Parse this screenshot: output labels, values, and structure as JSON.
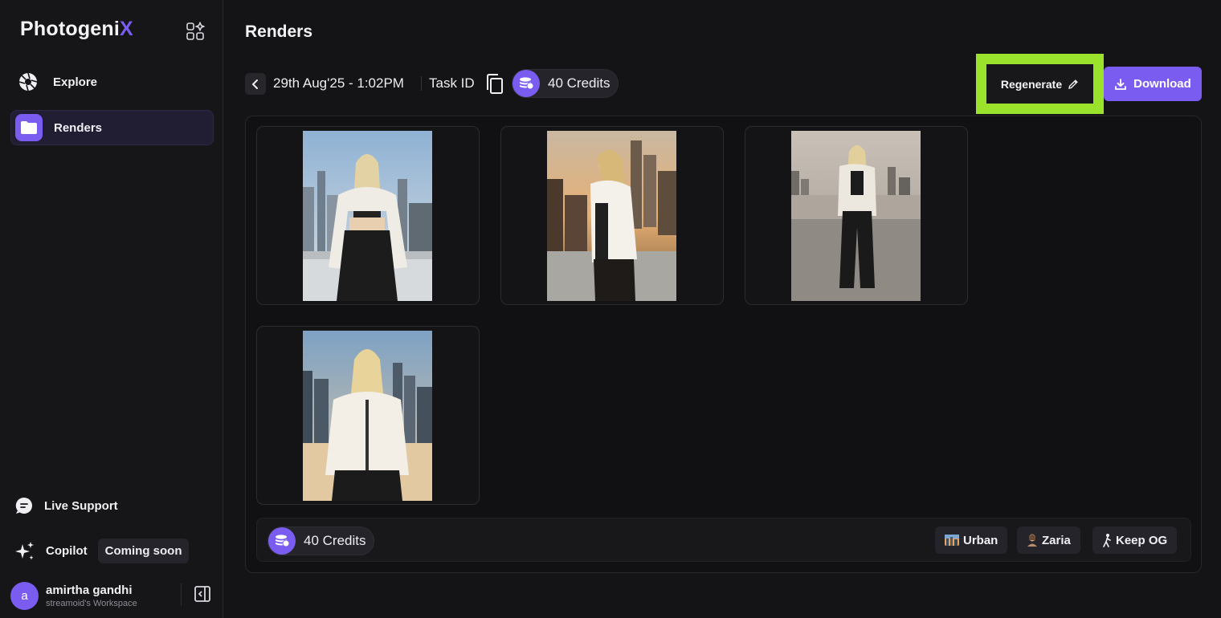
{
  "sidebar": {
    "logo_text": "Photogeni",
    "logo_accent": "X",
    "nav": [
      {
        "label": "Explore",
        "icon": "aperture-icon"
      },
      {
        "label": "Renders",
        "icon": "folder-icon"
      }
    ],
    "live_support": "Live Support",
    "copilot": "Copilot",
    "copilot_badge": "Coming soon",
    "user": {
      "avatar_letter": "a",
      "name": "amirtha gandhi",
      "workspace": "streamoid's Workspace"
    }
  },
  "main": {
    "title": "Renders",
    "task": {
      "date": "29th Aug'25 - 1:02PM",
      "task_id_label": "Task ID",
      "credits": "40 Credits"
    },
    "actions": {
      "regenerate": "Regenerate",
      "download": "Download"
    },
    "images": [
      {
        "description": "render-1"
      },
      {
        "description": "render-2"
      },
      {
        "description": "render-3"
      },
      {
        "description": "render-4"
      }
    ],
    "footer": {
      "credits": "40 Credits",
      "tags": [
        "Urban",
        "Zaria",
        "Keep OG"
      ]
    }
  },
  "colors": {
    "accent": "#7b5cf0",
    "highlight": "#9be22c",
    "background": "#141416"
  }
}
